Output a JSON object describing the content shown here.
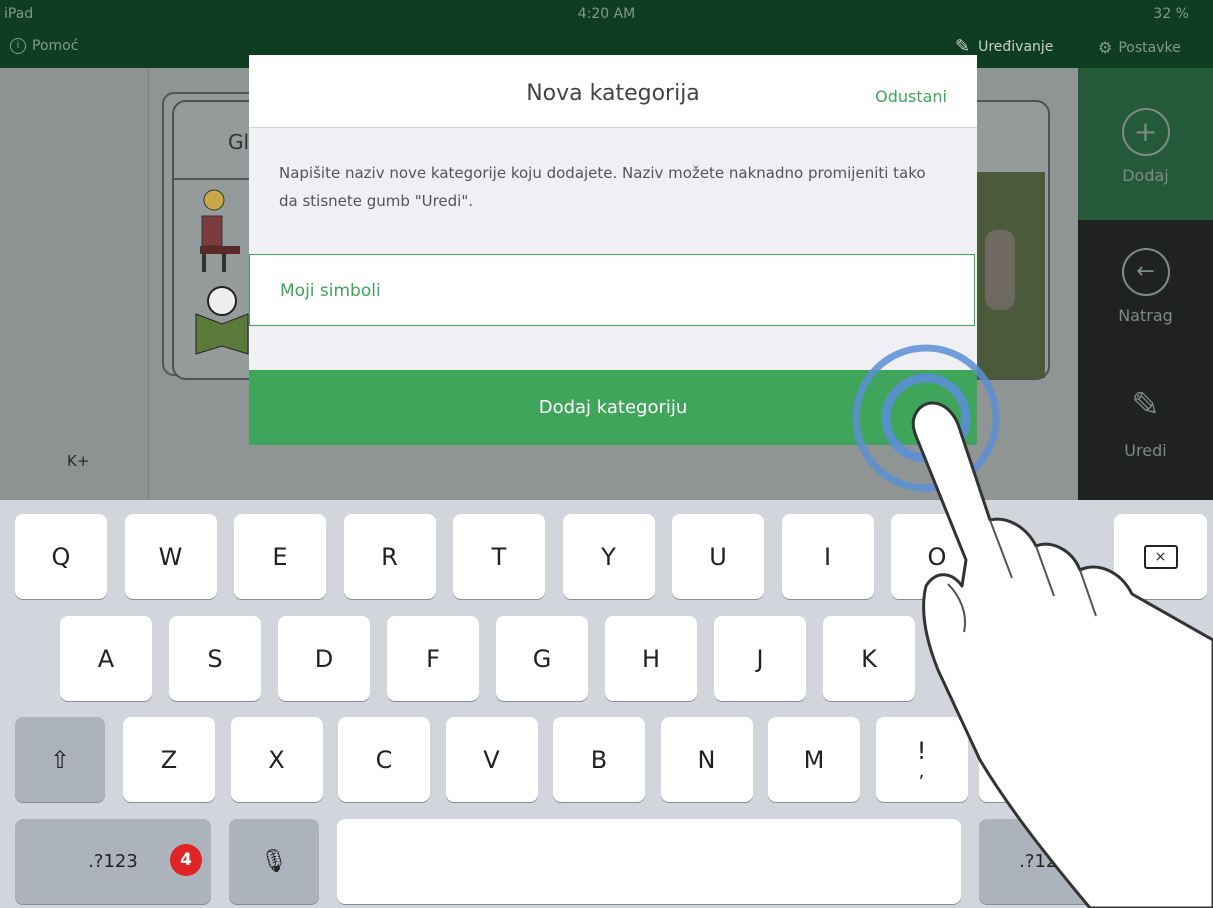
{
  "status_bar": {
    "carrier": "iPad",
    "time": "4:20 AM",
    "battery": "32 %",
    "help_label": "Pomoć",
    "edit_label": "Uređivanje",
    "settings_label": "Postavke"
  },
  "background": {
    "card_title_fragment": "Gl",
    "left_label": "K+",
    "sidebar": [
      {
        "label": "Dodaj",
        "icon": "plus-circle-icon"
      },
      {
        "label": "Natrag",
        "icon": "arrow-left-circle-icon"
      },
      {
        "label": "Uredi",
        "icon": "pencil-icon"
      }
    ]
  },
  "dialog": {
    "title": "Nova kategorija",
    "cancel_label": "Odustani",
    "description": "Napišite naziv nove kategorije koju dodajete. Naziv možete naknadno promijeniti tako da stisnete gumb \"Uredi\".",
    "input_value": "Moji simboli",
    "action_label": "Dodaj kategoriju"
  },
  "keyboard": {
    "row1": [
      "Q",
      "W",
      "E",
      "R",
      "T",
      "Y",
      "U",
      "I",
      "O"
    ],
    "row2": [
      "A",
      "S",
      "D",
      "F",
      "G",
      "H",
      "J",
      "K"
    ],
    "row3": [
      "Z",
      "X",
      "C",
      "V",
      "B",
      "N",
      "M",
      "!"
    ],
    "row3_secondary": ",",
    "num_label_left": ".?123",
    "num_label_right": ".?123",
    "step_badge": "4"
  },
  "colors": {
    "accent": "#3fa55b",
    "status_bar": "#0f3d22",
    "badge": "#e02424"
  }
}
